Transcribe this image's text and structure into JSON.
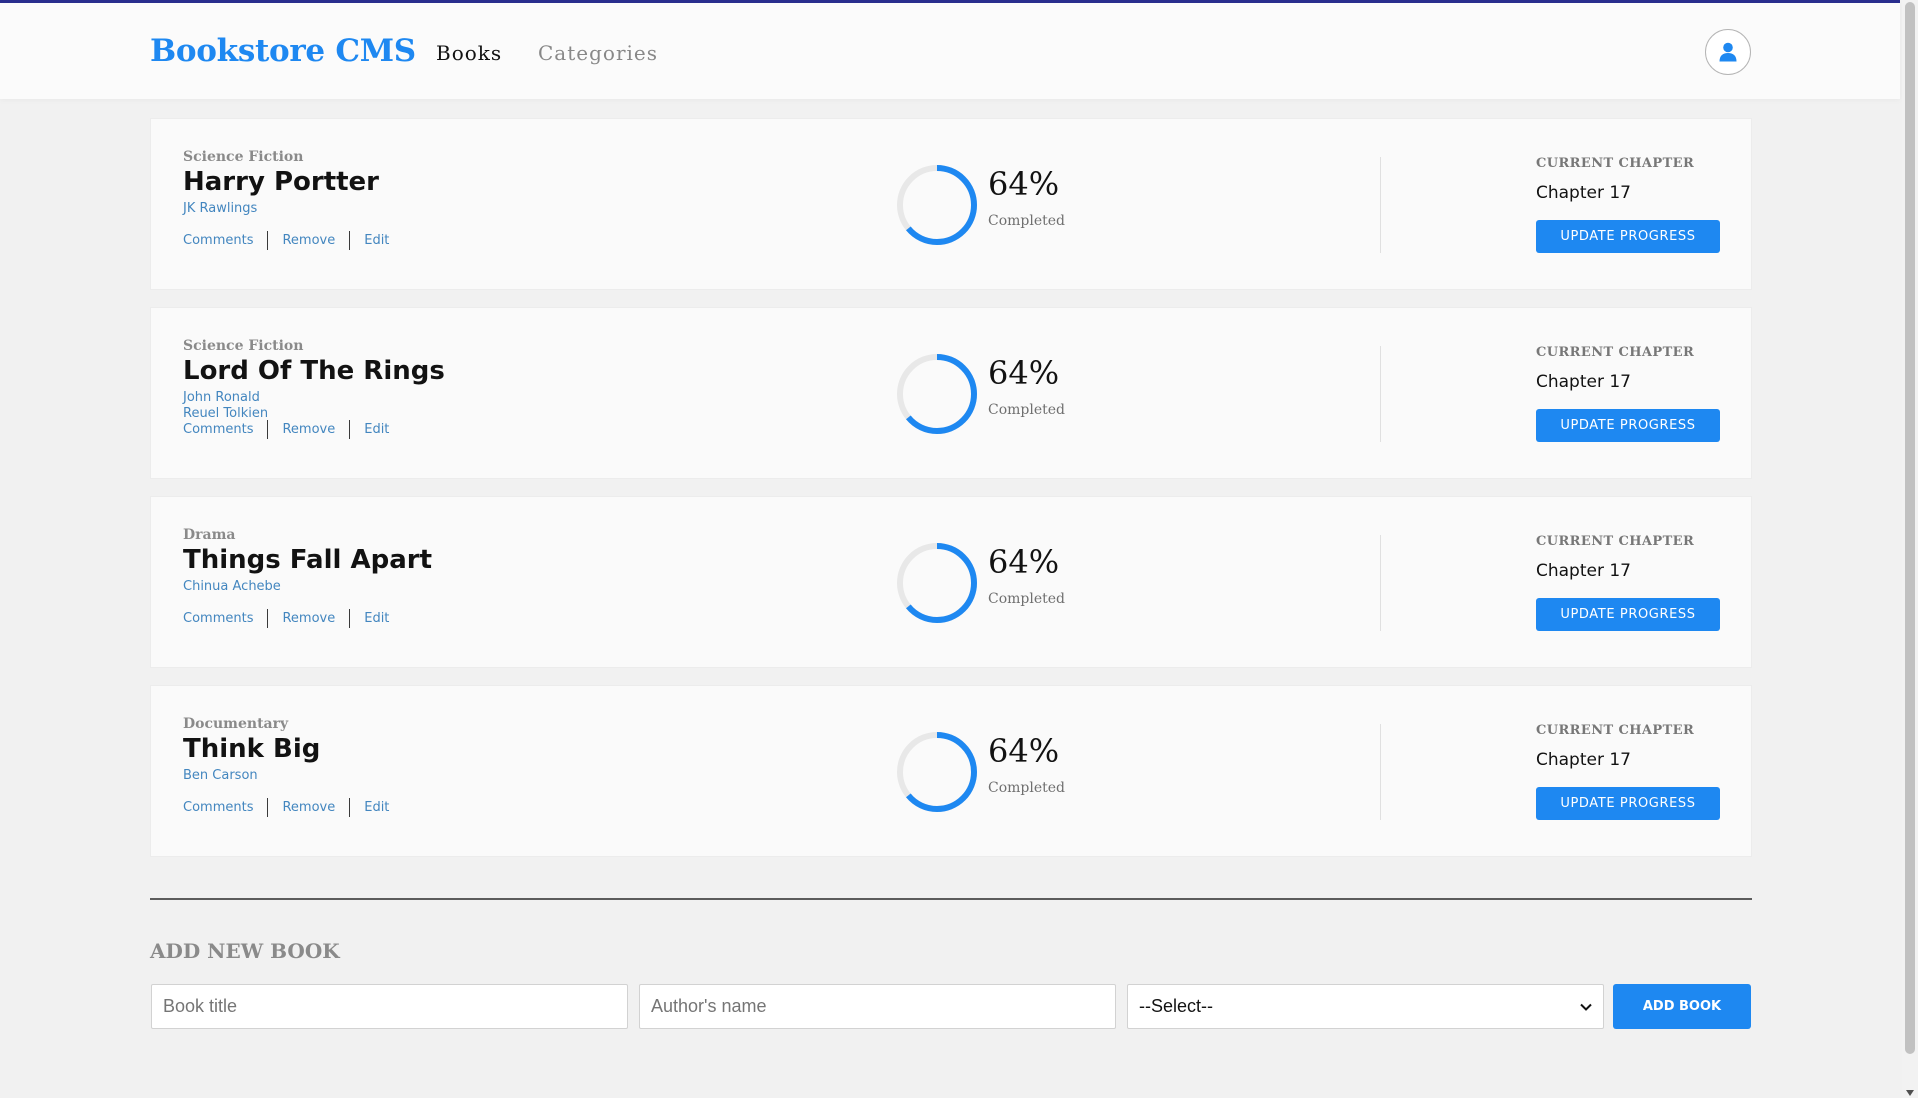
{
  "header": {
    "brand": "Bookstore CMS",
    "nav": [
      {
        "label": "Books",
        "active": true
      },
      {
        "label": "Categories",
        "active": false
      }
    ]
  },
  "books": [
    {
      "genre": "Science Fiction",
      "title": "Harry Portter",
      "author": "JK Rawlings",
      "actions": [
        "Comments",
        "Remove",
        "Edit"
      ],
      "progress": 64,
      "percent_label": "64%",
      "completed_label": "Completed",
      "chapter_label": "CURRENT CHAPTER",
      "chapter": "Chapter 17",
      "button": "UPDATE PROGRESS"
    },
    {
      "genre": "Science Fiction",
      "title": "Lord Of The Rings",
      "author": "John Ronald Reuel Tolkien",
      "actions": [
        "Comments",
        "Remove",
        "Edit"
      ],
      "progress": 64,
      "percent_label": "64%",
      "completed_label": "Completed",
      "chapter_label": "CURRENT CHAPTER",
      "chapter": "Chapter 17",
      "button": "UPDATE PROGRESS"
    },
    {
      "genre": "Drama",
      "title": "Things Fall Apart",
      "author": "Chinua Achebe",
      "actions": [
        "Comments",
        "Remove",
        "Edit"
      ],
      "progress": 64,
      "percent_label": "64%",
      "completed_label": "Completed",
      "chapter_label": "CURRENT CHAPTER",
      "chapter": "Chapter 17",
      "button": "UPDATE PROGRESS"
    },
    {
      "genre": "Documentary",
      "title": "Think Big",
      "author": "Ben Carson",
      "actions": [
        "Comments",
        "Remove",
        "Edit"
      ],
      "progress": 64,
      "percent_label": "64%",
      "completed_label": "Completed",
      "chapter_label": "CURRENT CHAPTER",
      "chapter": "Chapter 17",
      "button": "UPDATE PROGRESS"
    }
  ],
  "add_form": {
    "title": "ADD NEW BOOK",
    "title_placeholder": "Book title",
    "author_placeholder": "Author's name",
    "category_selected": "--Select--",
    "submit": "ADD BOOK"
  },
  "colors": {
    "accent": "#1e88f1",
    "link": "#4386bf",
    "ring_track": "#e8e8e8",
    "top_border": "#2b2f8f"
  },
  "icons": {
    "user": "user-icon",
    "select_arrow": "chevron-down-icon"
  }
}
